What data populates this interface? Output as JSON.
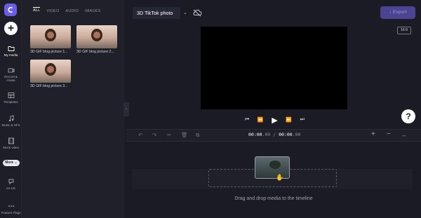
{
  "rail": {
    "more_label": "More",
    "items": [
      {
        "label": "My media",
        "icon": "folder-icon"
      },
      {
        "label": "Record & create",
        "icon": "camera-icon"
      },
      {
        "label": "Templates",
        "icon": "templates-icon"
      },
      {
        "label": "Music & SFX",
        "icon": "music-icon"
      },
      {
        "label": "Stock video",
        "icon": "film-icon"
      },
      {
        "label": "en-US",
        "icon": "language-icon"
      },
      {
        "label": "Feature Flags",
        "icon": "dots-icon"
      }
    ]
  },
  "media": {
    "tabs": [
      "ALL",
      "VIDEO",
      "AUDIO",
      "IMAGES"
    ],
    "active_tab": "ALL",
    "items": [
      {
        "caption": "3D GIF blog picture 1..."
      },
      {
        "caption": "3D GIF blog picture 2..."
      },
      {
        "caption": "3D GIF blog picture 3..."
      }
    ]
  },
  "header": {
    "project_title": "3D TikTok photo",
    "export_label": "Export",
    "aspect_ratio": "16:9"
  },
  "playback": {
    "time_current": "00:00",
    "time_current_ms": ".00",
    "separator": "/",
    "time_total": "00:00",
    "time_total_ms": ".00"
  },
  "timeline": {
    "hint": "Drag and drop media to the timeline"
  },
  "help_label": "?",
  "colors": {
    "background": "#1a1b24",
    "accent": "#6c5ce7",
    "export_button": "#4a4493"
  }
}
